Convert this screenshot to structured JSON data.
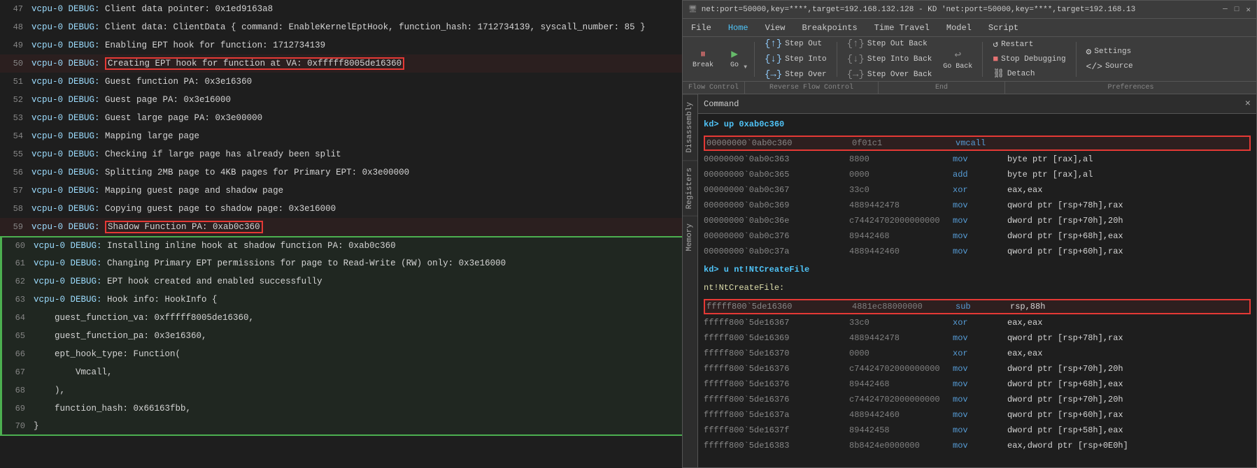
{
  "window": {
    "title": "net:port=50000,key=****,target=192.168.132.128 - KD 'net:port=50000,key=****,target=192.168.13"
  },
  "menu": {
    "items": [
      "File",
      "Home",
      "View",
      "Breakpoints",
      "Time Travel",
      "Model",
      "Script"
    ]
  },
  "toolbar": {
    "break_label": "Break",
    "go_label": "Go",
    "step_out_label": "Step Out",
    "step_out_back_label": "Step Out Back",
    "step_into_label": "Step Into",
    "step_into_back_label": "Step Into Back",
    "step_over_label": "Step Over",
    "step_over_back_label": "Step Over Back",
    "restart_label": "Restart",
    "stop_debugging_label": "Stop Debugging",
    "go_back_label": "Go Back",
    "detach_label": "Detach",
    "settings_label": "Settings",
    "source_label": "Source",
    "sections": {
      "flow_control": "Flow Control",
      "reverse_flow_control": "Reverse Flow Control",
      "end": "End",
      "preferences": "Preferences"
    }
  },
  "side_tabs": [
    "Disassembly",
    "Registers",
    "Memory"
  ],
  "command": {
    "label": "Command",
    "close_icon": "×"
  },
  "code_lines": [
    {
      "num": 47,
      "text": "vcpu-0 DEBUG: Client data pointer: 0x1ed9163a8",
      "type": "normal"
    },
    {
      "num": 48,
      "text": "vcpu-0 DEBUG: Client data: ClientData { command: EnableKernelEptHook, function_hash: 1712734139, syscall_number: 85 }",
      "type": "normal"
    },
    {
      "num": 49,
      "text": "vcpu-0 DEBUG: Enabling EPT hook for function: 1712734139",
      "type": "normal"
    },
    {
      "num": 50,
      "text": "vcpu-0 DEBUG: Creating EPT hook for function at VA: 0xfffff8005de16360",
      "type": "highlight-red"
    },
    {
      "num": 51,
      "text": "vcpu-0 DEBUG: Guest function PA: 0x3e16360",
      "type": "normal"
    },
    {
      "num": 52,
      "text": "vcpu-0 DEBUG: Guest page PA: 0x3e16000",
      "type": "normal"
    },
    {
      "num": 53,
      "text": "vcpu-0 DEBUG: Guest large page PA: 0x3e00000",
      "type": "normal"
    },
    {
      "num": 54,
      "text": "vcpu-0 DEBUG: Mapping large page",
      "type": "normal"
    },
    {
      "num": 55,
      "text": "vcpu-0 DEBUG: Checking if large page has already been split",
      "type": "normal"
    },
    {
      "num": 56,
      "text": "vcpu-0 DEBUG: Splitting 2MB page to 4KB pages for Primary EPT: 0x3e00000",
      "type": "normal"
    },
    {
      "num": 57,
      "text": "vcpu-0 DEBUG: Mapping guest page and shadow page",
      "type": "normal"
    },
    {
      "num": 58,
      "text": "vcpu-0 DEBUG: Copying guest page to shadow page: 0x3e16000",
      "type": "normal"
    },
    {
      "num": 59,
      "text": "vcpu-0 DEBUG: Shadow Function PA: 0xab0c360",
      "type": "highlight-red"
    },
    {
      "num": 60,
      "text": "vcpu-0 DEBUG: Installing inline hook at shadow function PA: 0xab0c360",
      "type": "green-block-start"
    },
    {
      "num": 61,
      "text": "vcpu-0 DEBUG: Changing Primary EPT permissions for page to Read-Write (RW) only: 0x3e16000",
      "type": "green-block"
    },
    {
      "num": 62,
      "text": "vcpu-0 DEBUG: EPT hook created and enabled successfully",
      "type": "green-block"
    },
    {
      "num": 63,
      "text": "vcpu-0 DEBUG: Hook info: HookInfo {",
      "type": "green-block"
    },
    {
      "num": 64,
      "text": "    guest_function_va: 0xfffff8005de16360,",
      "type": "green-block"
    },
    {
      "num": 65,
      "text": "    guest_function_pa: 0x3e16360,",
      "type": "green-block"
    },
    {
      "num": 66,
      "text": "    ept_hook_type: Function(",
      "type": "green-block"
    },
    {
      "num": 67,
      "text": "        Vmcall,",
      "type": "green-block"
    },
    {
      "num": 68,
      "text": "    ),",
      "type": "green-block"
    },
    {
      "num": 69,
      "text": "    function_hash: 0x66163fbb,",
      "type": "green-block"
    },
    {
      "num": 70,
      "text": "}",
      "type": "green-block-end"
    }
  ],
  "disasm": {
    "sections": [
      {
        "type": "prompt",
        "text": "kd> up 0xab0c360"
      },
      {
        "type": "lines",
        "highlighted_index": 0,
        "items": [
          {
            "addr": "00000000`0ab0c360",
            "bytes": "0f01c1",
            "mnemonic": "vmcall",
            "operands": "",
            "comment": "",
            "highlight": true
          },
          {
            "addr": "00000000`0ab0c363",
            "bytes": "8800",
            "mnemonic": "mov",
            "operands": "byte ptr [rax],al",
            "comment": ""
          },
          {
            "addr": "00000000`0ab0c365",
            "bytes": "0000",
            "mnemonic": "add",
            "operands": "byte ptr [rax],al",
            "comment": ""
          },
          {
            "addr": "00000000`0ab0c367",
            "bytes": "33c0",
            "mnemonic": "xor",
            "operands": "eax,eax",
            "comment": ""
          },
          {
            "addr": "00000000`0ab0c369",
            "bytes": "4889442478",
            "mnemonic": "mov",
            "operands": "qword ptr [rsp+78h],rax",
            "comment": ""
          },
          {
            "addr": "00000000`0ab0c36e",
            "bytes": "c74424702000000000",
            "mnemonic": "mov",
            "operands": "dword ptr [rsp+70h],20h",
            "comment": ""
          },
          {
            "addr": "00000000`0ab0c376",
            "bytes": "89442468",
            "mnemonic": "mov",
            "operands": "dword ptr [rsp+68h],eax",
            "comment": ""
          },
          {
            "addr": "00000000`0ab0c37a",
            "bytes": "4889442460",
            "mnemonic": "mov",
            "operands": "qword ptr [rsp+60h],rax",
            "comment": ""
          }
        ]
      },
      {
        "type": "prompt",
        "text": "kd> u nt!NtCreateFile"
      },
      {
        "type": "label",
        "text": "nt!NtCreateFile:"
      },
      {
        "type": "lines",
        "highlighted_index": 0,
        "items": [
          {
            "addr": "fffff800`5de16360",
            "bytes": "4881ec88000000",
            "mnemonic": "sub",
            "operands": "rsp,88h",
            "comment": "",
            "highlight": true
          },
          {
            "addr": "fffff800`5de16367",
            "bytes": "33c0",
            "mnemonic": "xor",
            "operands": "eax,eax",
            "comment": ""
          },
          {
            "addr": "fffff800`5de16369",
            "bytes": "4889442478",
            "mnemonic": "mov",
            "operands": "qword ptr [rsp+78h],rax",
            "comment": ""
          },
          {
            "addr": "fffff800`5de16370",
            "bytes": "0000",
            "mnemonic": "xor",
            "operands": "eax,eax",
            "comment": ""
          },
          {
            "addr": "fffff800`5de16376",
            "bytes": "c74424702000000000",
            "mnemonic": "mov",
            "operands": "dword ptr [rsp+70h],20h",
            "comment": ""
          },
          {
            "addr": "fffff800`5de16376",
            "bytes": "89442468",
            "mnemonic": "mov",
            "operands": "dword ptr [rsp+68h],eax",
            "comment": ""
          },
          {
            "addr": "fffff800`5de16376",
            "bytes": "c74424702000000000",
            "mnemonic": "mov",
            "operands": "dword ptr [rsp+70h],20h",
            "comment": ""
          },
          {
            "addr": "fffff800`5de1637a",
            "bytes": "4889442460",
            "mnemonic": "mov",
            "operands": "qword ptr [rsp+60h],rax",
            "comment": ""
          },
          {
            "addr": "fffff800`5de1637f",
            "bytes": "89442458",
            "mnemonic": "mov",
            "operands": "dword ptr [rsp+58h],eax",
            "comment": ""
          },
          {
            "addr": "fffff800`5de16383",
            "bytes": "8b8424e0000000",
            "mnemonic": "mov",
            "operands": "eax,dword ptr [rsp+0E0h]",
            "comment": ""
          }
        ]
      }
    ]
  },
  "colors": {
    "accent_blue": "#4fc3f7",
    "red_highlight": "#e53935",
    "green_highlight": "#4caf50",
    "bg_dark": "#1e1e1e",
    "bg_mid": "#2d2d2d",
    "bg_light": "#3c3c3c"
  }
}
